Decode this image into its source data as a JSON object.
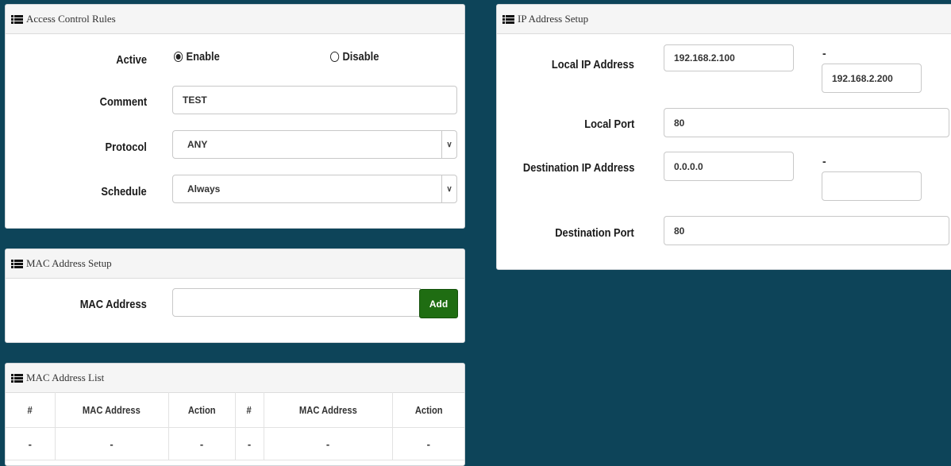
{
  "access_control": {
    "title": "Access Control Rules",
    "active_label": "Active",
    "enable_label": "Enable",
    "disable_label": "Disable",
    "active_selected": "Enable",
    "comment_label": "Comment",
    "comment_value": "TEST",
    "protocol_label": "Protocol",
    "protocol_value": "ANY",
    "schedule_label": "Schedule",
    "schedule_value": "Always"
  },
  "mac_setup": {
    "title": "MAC Address Setup",
    "mac_label": "MAC Address",
    "mac_value": "",
    "add_label": "Add"
  },
  "mac_list": {
    "title": "MAC Address List",
    "columns": [
      "#",
      "MAC Address",
      "Action",
      "#",
      "MAC Address",
      "Action"
    ],
    "rows": [
      [
        "-",
        "-",
        "-",
        "-",
        "-",
        "-"
      ]
    ]
  },
  "ip_setup": {
    "title": "IP Address Setup",
    "local_ip_label": "Local IP Address",
    "local_ip_start": "192.168.2.100",
    "local_ip_end": "192.168.2.200",
    "local_port_label": "Local Port",
    "local_port_value": "80",
    "dest_ip_label": "Destination IP Address",
    "dest_ip_start": "0.0.0.0",
    "dest_ip_end": "",
    "dest_port_label": "Destination Port",
    "dest_port_value": "80",
    "range_separator": "-"
  },
  "icons": {
    "panel_header_icon": "list-grid-icon",
    "select_caret": "chevron-down-icon"
  }
}
